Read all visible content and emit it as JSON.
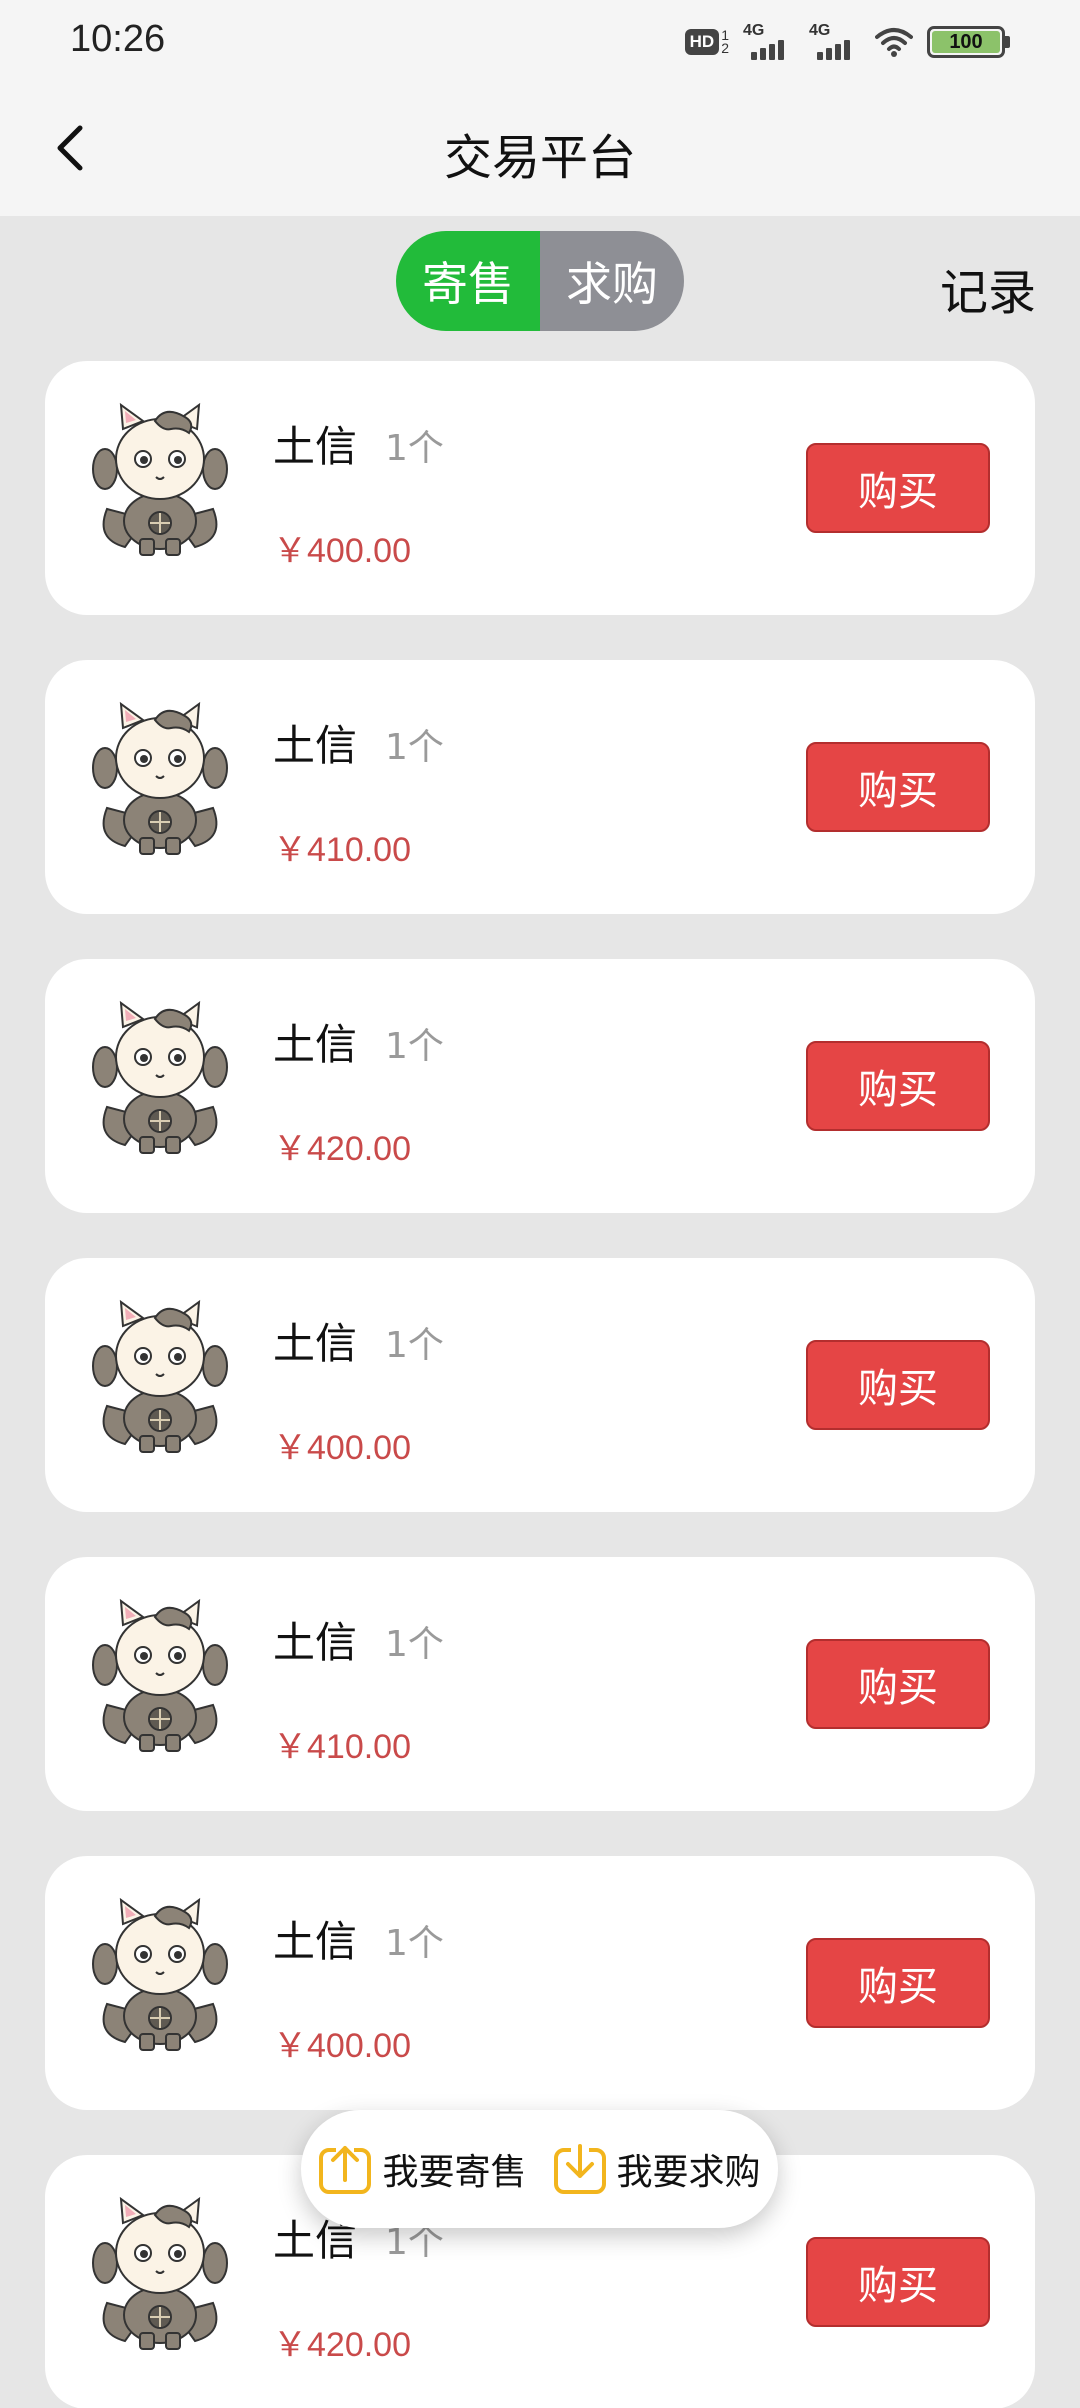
{
  "status_bar": {
    "time": "10:26",
    "hd_label": "HD",
    "hd_sub_top": "1",
    "hd_sub_bottom": "2",
    "signal1_label": "4G",
    "signal2_label": "4G",
    "battery": "100"
  },
  "header": {
    "title": "交易平台"
  },
  "tabs": {
    "sell_label": "寄售",
    "buy_label": "求购",
    "active": "寄售"
  },
  "record_label": "记录",
  "listings": [
    {
      "name": "土信",
      "qty": "1个",
      "price": "￥400.00",
      "button": "购买"
    },
    {
      "name": "土信",
      "qty": "1个",
      "price": "￥410.00",
      "button": "购买"
    },
    {
      "name": "土信",
      "qty": "1个",
      "price": "￥420.00",
      "button": "购买"
    },
    {
      "name": "土信",
      "qty": "1个",
      "price": "￥400.00",
      "button": "购买"
    },
    {
      "name": "土信",
      "qty": "1个",
      "price": "￥410.00",
      "button": "购买"
    },
    {
      "name": "土信",
      "qty": "1个",
      "price": "￥400.00",
      "button": "购买"
    },
    {
      "name": "土信",
      "qty": "1个",
      "price": "￥420.00",
      "button": "购买"
    }
  ],
  "fab": {
    "sell_label": "我要寄售",
    "buy_label": "我要求购"
  },
  "colors": {
    "accent_green": "#22bb3a",
    "buy_red": "#e54545",
    "price_red": "#c94a4a",
    "fab_icon": "#f2b51d"
  }
}
